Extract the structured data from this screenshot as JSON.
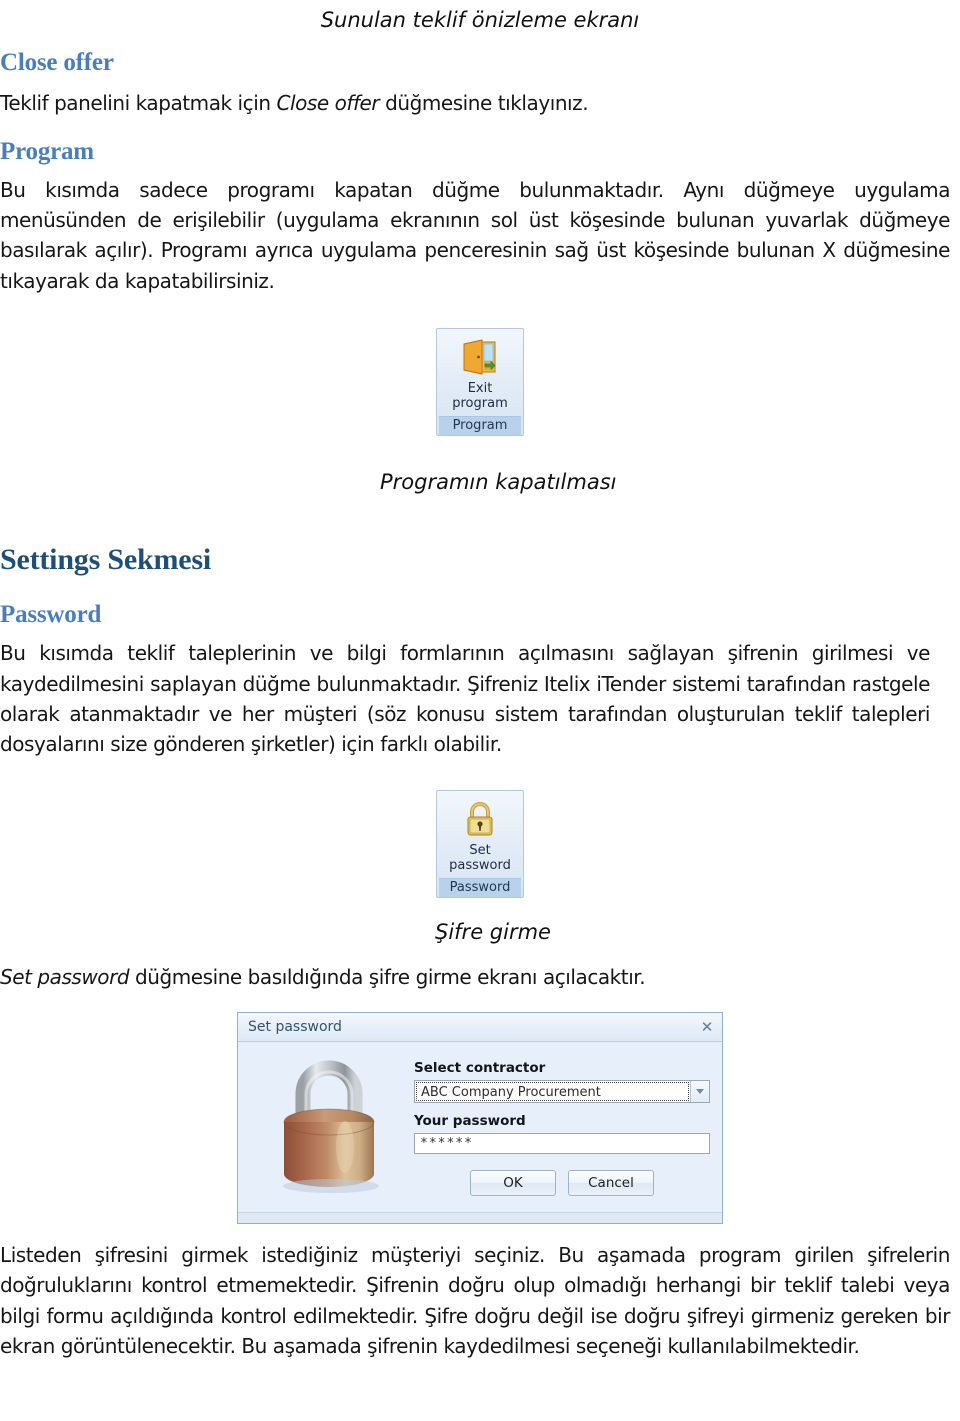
{
  "document": {
    "top_caption": "Sunulan teklif önizleme ekranı",
    "sections": [
      {
        "heading": "Close offer",
        "heading_level": "h2",
        "paragraph_pre": "Teklif panelini kapatmak için ",
        "paragraph_em": "Close offer",
        "paragraph_post": " düğmesine tıklayınız."
      },
      {
        "heading": "Program",
        "heading_level": "h2",
        "paragraph": "Bu kısımda sadece programı kapatan düğme bulunmaktadır. Aynı düğmeye uygulama menüsünden de erişilebilir (uygulama ekranının sol üst köşesinde bulunan yuvarlak düğmeye basılarak açılır). Programı ayrıca uygulama penceresinin sağ üst köşesinde bulunan X düğmesine tıkayarak da kapatabilirsiniz."
      }
    ],
    "exit_button": {
      "icon": "exit-door-icon",
      "label_line1": "Exit",
      "label_line2": "program",
      "group_label": "Program"
    },
    "exit_caption": "Programın kapatılması",
    "settings_heading": "Settings Sekmesi",
    "password_heading": "Password",
    "password_paragraph": "Bu kısımda teklif taleplerinin ve bilgi formlarının açılmasını sağlayan şifrenin girilmesi ve kaydedilmesini saplayan düğme bulunmaktadır. Şifreniz Itelix iTender sistemi tarafından rastgele olarak atanmaktadır ve her müşteri (söz konusu sistem tarafından oluşturulan teklif talepleri dosyalarını size gönderen şirketler) için farklı olabilir.",
    "setpassword_button": {
      "icon": "padlock-icon",
      "label_line1": "Set",
      "label_line2": "password",
      "group_label": "Password"
    },
    "setpassword_caption": "Şifre girme",
    "setpassword_sentence_em": "Set password",
    "setpassword_sentence_post": " düğmesine basıldığında şifre girme ekranı açılacaktır.",
    "bottom_paragraph": "Listeden şifresini girmek istediğiniz müşteriyi seçiniz. Bu aşamada program girilen şifrelerin doğruluklarını kontrol etmemektedir. Şifrenin doğru olup olmadığı herhangi bir teklif talebi veya bilgi formu açıldığında kontrol edilmektedir. Şifre doğru değil ise doğru şifreyi girmeniz gereken bir ekran görüntülenecektir. Bu aşamada şifrenin kaydedilmesi seçeneği kullanılabilmektedir."
  },
  "dialog": {
    "title": "Set password",
    "close_icon": "✕",
    "image_icon": "padlock-large-icon",
    "select_contractor_label": "Select contractor",
    "select_contractor_value": "ABC Company Procurement",
    "your_password_label": "Your password",
    "your_password_value": "******",
    "ok_label": "OK",
    "cancel_label": "Cancel"
  },
  "colors": {
    "heading_dark": "#1f4e79",
    "heading_light": "#4a7ebb",
    "dialog_bg": "#e7effa",
    "ribbon_group_bg": "#b9d2ec"
  }
}
